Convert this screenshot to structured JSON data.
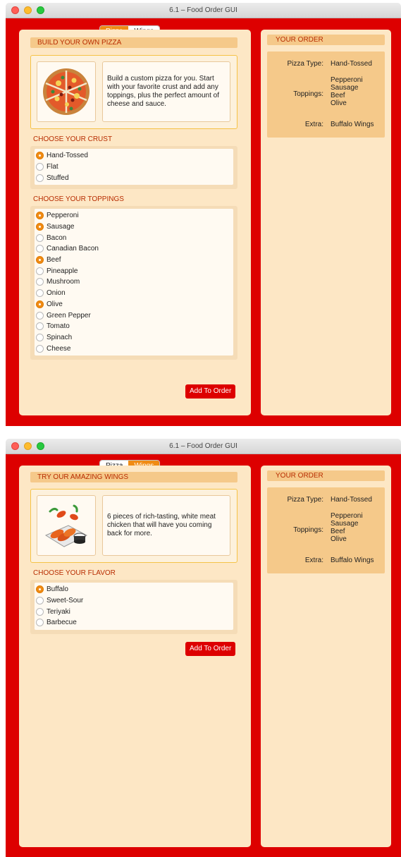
{
  "window_title": "6.1 – Food Order GUI",
  "tabs": {
    "pizza": "Pizza",
    "wings": "Wings"
  },
  "pizza": {
    "header": "BUILD YOUR OWN PIZZA",
    "description": "Build a custom pizza for you. Start with your favorite crust and add any toppings, plus the perfect amount of cheese and sauce.",
    "image_icon": "pizza-icon",
    "crust_title": "CHOOSE YOUR CRUST",
    "crusts": [
      {
        "label": "Hand-Tossed",
        "selected": true
      },
      {
        "label": "Flat",
        "selected": false
      },
      {
        "label": "Stuffed",
        "selected": false
      }
    ],
    "toppings_title": "CHOOSE YOUR TOPPINGS",
    "toppings": [
      {
        "label": "Pepperoni",
        "selected": true
      },
      {
        "label": "Sausage",
        "selected": true
      },
      {
        "label": "Bacon",
        "selected": false
      },
      {
        "label": "Canadian Bacon",
        "selected": false
      },
      {
        "label": "Beef",
        "selected": true
      },
      {
        "label": "Pineapple",
        "selected": false
      },
      {
        "label": "Mushroom",
        "selected": false
      },
      {
        "label": "Onion",
        "selected": false
      },
      {
        "label": "Olive",
        "selected": true
      },
      {
        "label": "Green Pepper",
        "selected": false
      },
      {
        "label": "Tomato",
        "selected": false
      },
      {
        "label": "Spinach",
        "selected": false
      },
      {
        "label": "Cheese",
        "selected": false
      }
    ],
    "add_button": "Add To Order"
  },
  "wings": {
    "header": "TRY OUR AMAZING WINGS",
    "description": "6 pieces of rich-tasting, white meat chicken that will have you coming back for more.",
    "image_icon": "wings-icon",
    "flavor_title": "CHOOSE YOUR FLAVOR",
    "flavors": [
      {
        "label": "Buffalo",
        "selected": true
      },
      {
        "label": "Sweet-Sour",
        "selected": false
      },
      {
        "label": "Teriyaki",
        "selected": false
      },
      {
        "label": "Barbecue",
        "selected": false
      }
    ],
    "add_button": "Add To Order"
  },
  "order": {
    "header": "YOUR ORDER",
    "pizza_type_label": "Pizza Type:",
    "pizza_type": "Hand-Tossed",
    "toppings_label": "Toppings:",
    "toppings": [
      "Pepperoni",
      "Sausage",
      "Beef",
      "Olive"
    ],
    "extra_label": "Extra:",
    "extra": "Buffalo Wings"
  },
  "colors": {
    "background": "#dd0000",
    "panel": "#fde7c5",
    "accent": "#f08b14",
    "header_text": "#b82c00"
  }
}
